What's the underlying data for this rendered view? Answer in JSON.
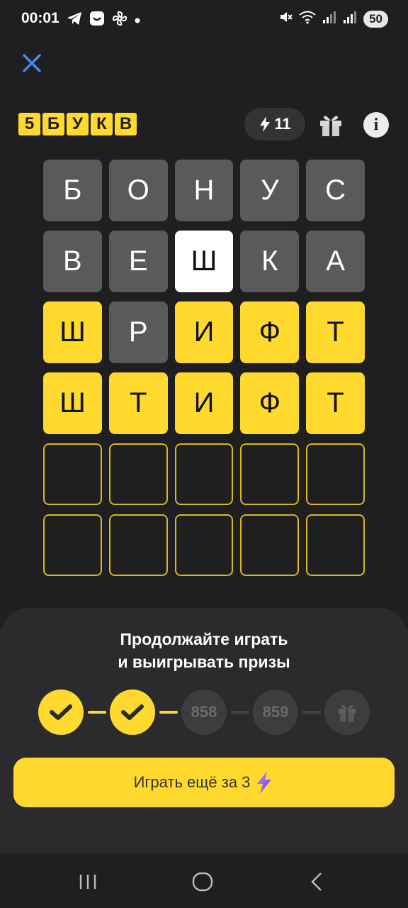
{
  "status_bar": {
    "time": "00:01",
    "battery": "50",
    "icons": [
      "telegram-icon",
      "app-icon",
      "fan-icon",
      "dot-icon",
      "mute-icon",
      "wifi-icon",
      "signal-icon",
      "signal-icon-2"
    ]
  },
  "header": {
    "logo_letters": [
      "5",
      "Б",
      "У",
      "К",
      "В"
    ],
    "energy_count": "11",
    "energy_icon": "lightning-icon",
    "gift_icon": "gift-icon",
    "info_label": "i"
  },
  "board": {
    "rows": [
      [
        {
          "letter": "Б",
          "state": "absent"
        },
        {
          "letter": "О",
          "state": "absent"
        },
        {
          "letter": "Н",
          "state": "absent"
        },
        {
          "letter": "У",
          "state": "absent"
        },
        {
          "letter": "С",
          "state": "absent"
        }
      ],
      [
        {
          "letter": "В",
          "state": "absent"
        },
        {
          "letter": "Е",
          "state": "absent"
        },
        {
          "letter": "Ш",
          "state": "active"
        },
        {
          "letter": "К",
          "state": "absent"
        },
        {
          "letter": "А",
          "state": "absent"
        }
      ],
      [
        {
          "letter": "Ш",
          "state": "correct"
        },
        {
          "letter": "Р",
          "state": "absent"
        },
        {
          "letter": "И",
          "state": "correct"
        },
        {
          "letter": "Ф",
          "state": "correct"
        },
        {
          "letter": "Т",
          "state": "correct"
        }
      ],
      [
        {
          "letter": "Ш",
          "state": "correct"
        },
        {
          "letter": "Т",
          "state": "correct"
        },
        {
          "letter": "И",
          "state": "correct"
        },
        {
          "letter": "Ф",
          "state": "correct"
        },
        {
          "letter": "Т",
          "state": "correct"
        }
      ],
      [
        {
          "letter": "",
          "state": "empty"
        },
        {
          "letter": "",
          "state": "empty"
        },
        {
          "letter": "",
          "state": "empty"
        },
        {
          "letter": "",
          "state": "empty"
        },
        {
          "letter": "",
          "state": "empty"
        }
      ],
      [
        {
          "letter": "",
          "state": "empty"
        },
        {
          "letter": "",
          "state": "empty"
        },
        {
          "letter": "",
          "state": "empty"
        },
        {
          "letter": "",
          "state": "empty"
        },
        {
          "letter": "",
          "state": "empty"
        }
      ]
    ]
  },
  "sheet": {
    "title_line1": "Продолжайте играть",
    "title_line2": "и выигрывать призы",
    "steps": [
      {
        "type": "done",
        "label": ""
      },
      {
        "type": "done",
        "label": ""
      },
      {
        "type": "pending",
        "label": "858"
      },
      {
        "type": "pending",
        "label": "859"
      },
      {
        "type": "gift",
        "label": ""
      }
    ],
    "play_button_label": "Играть ещё за 3"
  },
  "colors": {
    "accent": "#ffd92e",
    "background": "#1f1f21",
    "tile_absent": "#5a5a5c",
    "sheet": "#2b2b2d"
  }
}
